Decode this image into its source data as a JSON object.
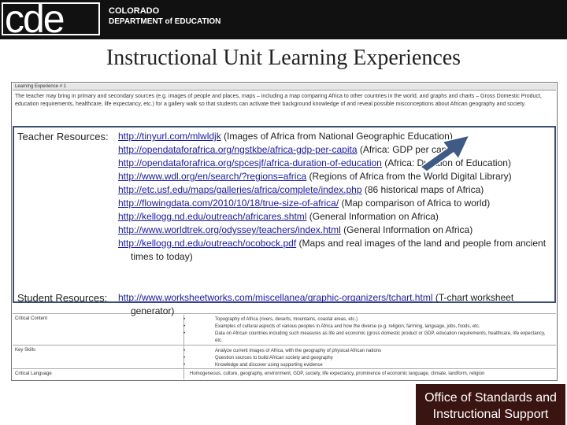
{
  "header": {
    "logo_text": "cde",
    "dept_line1": "COLORADO",
    "dept_line2": "DEPARTMENT of EDUCATION"
  },
  "slide": {
    "title": "Instructional Unit Learning Experiences"
  },
  "doc": {
    "experience_label": "Learning Experience # 1",
    "experience_desc": "The teacher may bring in primary and secondary sources (e.g. images of people and places, maps – including a map comparing Africa to other countries in the world, and graphs and charts – Gross Domestic Product, education requirements, healthcare, life expectancy, etc.) for a gallery walk so that students can activate their background knowledge of and reveal possible misconceptions about African geography and society.",
    "rows": [
      {
        "label": "Critical Content",
        "bullets": [
          "Topography of Africa (rivers, deserts, mountains, coastal areas, etc.)",
          "Examples of cultural aspects of various peoples in Africa and how the diverse (e.g. religion, farming, language, jobs, foods, etc.",
          "Data on African countries including such measures as life and economic (gross domestic product or GDP, education requirements, healthcare, life expectancy, etc."
        ]
      },
      {
        "label": "Key Skills",
        "bullets": [
          "Analyze current images of Africa, with the geography of physical African nations",
          "Question sources to build African society and geography",
          "Knowledge and discover using supporting evidence"
        ]
      },
      {
        "label": "Critical Language",
        "text": "Homogeneous, culture, geography, environment, GDP, society, life expectancy, prominence of economic language, climate, landform, religion"
      }
    ]
  },
  "resources": {
    "teacher_label": "Teacher Resources:",
    "student_label": "Student Resources:",
    "teacher_items": [
      {
        "url": "http://tinyurl.com/mlwldjk",
        "desc": " (Images of Africa from National Geographic Education)"
      },
      {
        "url": "http://opendataforafrica.org/ngstkbe/africa-gdp-per-capita",
        "desc": " (Africa: GDP per capita)"
      },
      {
        "url": "http://opendataforafrica.org/spcesjf/africa-duration-of-education",
        "desc": " (Africa: Duration of Education)"
      },
      {
        "url": "http://www.wdl.org/en/search/?regions=africa",
        "desc": " (Regions of Africa from the World Digital Library)"
      },
      {
        "url": "http://etc.usf.edu/maps/galleries/africa/complete/index.php",
        "desc": " (86 historical maps of Africa)"
      },
      {
        "url": "http://flowingdata.com/2010/10/18/true-size-of-africa/",
        "desc": " (Map comparison of Africa to world)"
      },
      {
        "url": "http://kellogg.nd.edu/outreach/africares.shtml",
        "desc": " (General Information on Africa)"
      },
      {
        "url": "http://www.worldtrek.org/odyssey/teachers/index.html",
        "desc": " (General Information on Africa)"
      },
      {
        "url": "http://kellogg.nd.edu/outreach/ocobock.pdf",
        "desc": " (Maps and real images of the land and people from ancient times to today)"
      }
    ],
    "student_item": {
      "url": "http://www.worksheetworks.com/miscellanea/graphic-organizers/tchart.html",
      "desc": " (T-chart worksheet generator)"
    }
  },
  "footer": {
    "line1": "Office of Standards and",
    "line2": "Instructional Support"
  },
  "colors": {
    "header_bg": "#111111",
    "overlay_border": "#3c4f76",
    "arrow": "#3f5a86",
    "footer_bg": "#3a1410",
    "link": "#1a1aa6"
  }
}
